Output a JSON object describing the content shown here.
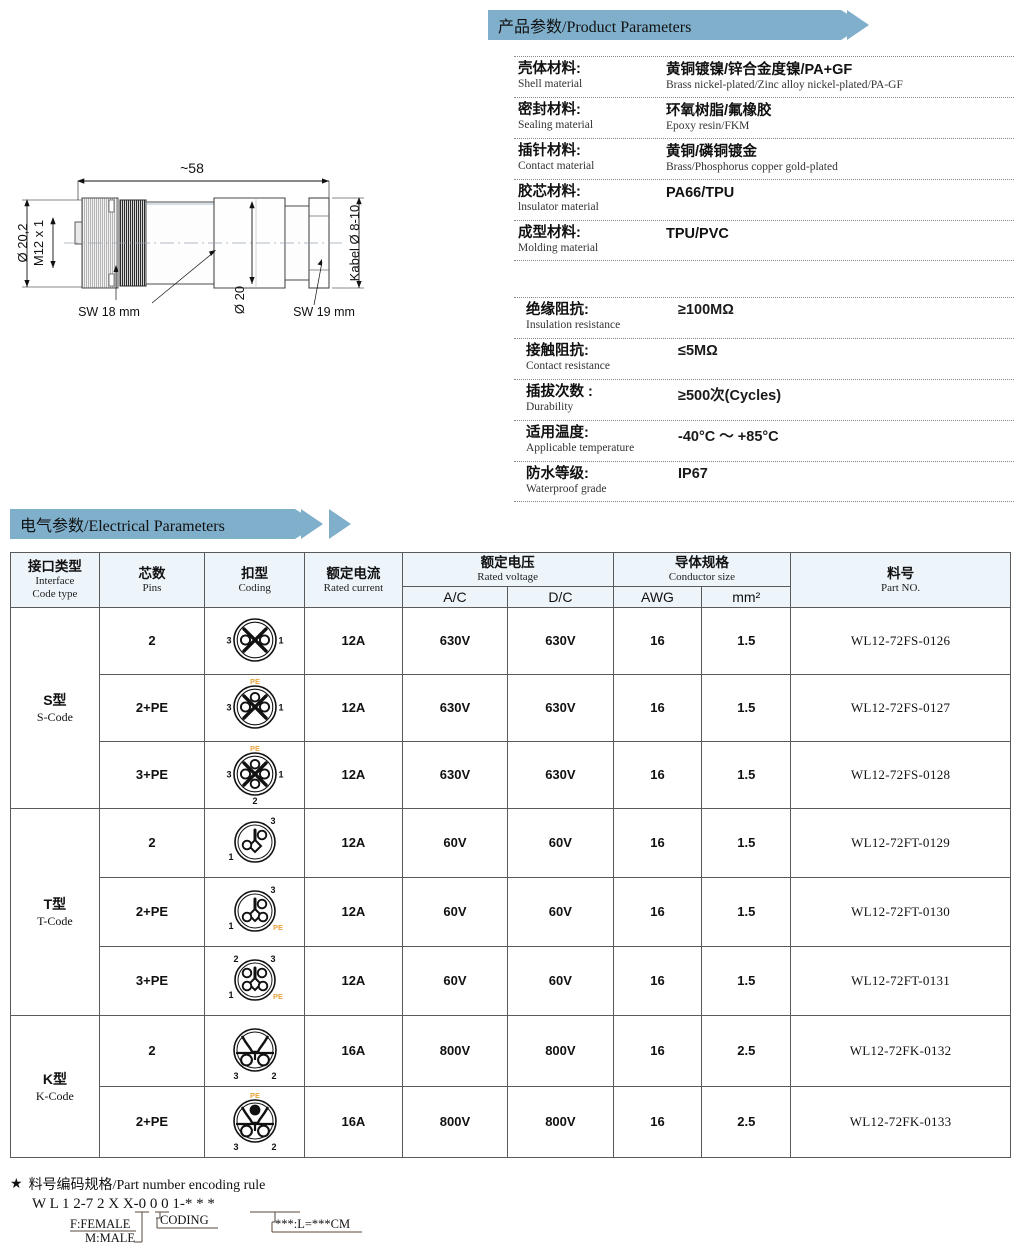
{
  "banners": {
    "product": "产品参数/Product Parameters",
    "electrical": "电气参数/Electrical Parameters"
  },
  "colors": {
    "banner_fill": "#7fafcb",
    "table_header_bg": "#edf4fa",
    "table_border": "#5a5a5a",
    "pe_label": "#E8A33D"
  },
  "drawing": {
    "name": "m12-connector-side-view",
    "dim_length": "~58",
    "dim_outer_diameter": "Ø 20,2",
    "dim_thread": "M12 x 1",
    "dim_body_diameter": "Ø 20",
    "dim_cable": "Kabel Ø 8-10",
    "callout_sw18": "SW 18 mm",
    "callout_sw19": "SW 19 mm"
  },
  "product_parameters": {
    "materials": [
      {
        "label_cn": "壳体材料:",
        "label_en": "Shell material",
        "value_cn": "黄铜镀镍/锌合金度镍/PA+GF",
        "value_en": "Brass nickel-plated/Zinc alloy nickel-plated/PA-GF"
      },
      {
        "label_cn": "密封材料:",
        "label_en": "Sealing material",
        "value_cn": "环氧树脂/氟橡胶",
        "value_en": "Epoxy resin/FKM"
      },
      {
        "label_cn": "插针材料:",
        "label_en": "Contact material",
        "value_cn": "黄铜/磷铜镀金",
        "value_en": "Brass/Phosphorus copper gold-plated"
      },
      {
        "label_cn": "胶芯材料:",
        "label_en": "lnsulator material",
        "value_cn": "PA66/TPU",
        "value_en": ""
      },
      {
        "label_cn": "成型材料:",
        "label_en": "Molding material",
        "value_cn": "TPU/PVC",
        "value_en": ""
      }
    ],
    "performance": [
      {
        "label_cn": "绝缘阻抗:",
        "label_en": "Insulation resistance",
        "value": "≥100MΩ"
      },
      {
        "label_cn": "接触阻抗:",
        "label_en": "Contact resistance",
        "value": "≤5MΩ"
      },
      {
        "label_cn": "插拔次数 :",
        "label_en": "Durability",
        "value": "≥500次(Cycles)"
      },
      {
        "label_cn": "适用温度:",
        "label_en": "Applicable temperature",
        "value": "-40°C ～ +85°C"
      },
      {
        "label_cn": "防水等级:",
        "label_en": "Waterproof grade",
        "value": "IP67"
      }
    ]
  },
  "electrical_table": {
    "headers": {
      "interface_cn": "接口类型",
      "interface_en_1": "Interface",
      "interface_en_2": "Code  type",
      "pins_cn": "芯数",
      "pins_en": "Pins",
      "coding_cn": "扣型",
      "coding_en": "Coding",
      "current_cn": "额定电流",
      "current_en": "Rated current",
      "voltage_cn": "额定电压",
      "voltage_en": "Rated voltage",
      "voltage_ac": "A/C",
      "voltage_dc": "D/C",
      "conductor_cn": "导体规格",
      "conductor_en": "Conductor size",
      "conductor_awg": "AWG",
      "conductor_mm2": "mm²",
      "partno_cn": "料号",
      "partno_en": "Part NO."
    },
    "groups": [
      {
        "code_cn": "S型",
        "code_en": "S-Code",
        "pin_style": "s",
        "rows": [
          {
            "pins": "2",
            "pin_labels": [
              "3",
              "1"
            ],
            "current": "12A",
            "ac": "630V",
            "dc": "630V",
            "awg": "16",
            "mm2": "1.5",
            "part_no": "WL12-72FS-0126"
          },
          {
            "pins": "2+PE",
            "pin_labels": [
              "3",
              "1",
              "PE"
            ],
            "current": "12A",
            "ac": "630V",
            "dc": "630V",
            "awg": "16",
            "mm2": "1.5",
            "part_no": "WL12-72FS-0127"
          },
          {
            "pins": "3+PE",
            "pin_labels": [
              "3",
              "1",
              "PE",
              "2"
            ],
            "current": "12A",
            "ac": "630V",
            "dc": "630V",
            "awg": "16",
            "mm2": "1.5",
            "part_no": "WL12-72FS-0128"
          }
        ]
      },
      {
        "code_cn": "T型",
        "code_en": "T-Code",
        "pin_style": "t",
        "rows": [
          {
            "pins": "2",
            "pin_labels": [
              "1",
              "3"
            ],
            "current": "12A",
            "ac": "60V",
            "dc": "60V",
            "awg": "16",
            "mm2": "1.5",
            "part_no": "WL12-72FT-0129"
          },
          {
            "pins": "2+PE",
            "pin_labels": [
              "1",
              "3",
              "PE"
            ],
            "current": "12A",
            "ac": "60V",
            "dc": "60V",
            "awg": "16",
            "mm2": "1.5",
            "part_no": "WL12-72FT-0130"
          },
          {
            "pins": "3+PE",
            "pin_labels": [
              "1",
              "2",
              "3",
              "PE"
            ],
            "current": "12A",
            "ac": "60V",
            "dc": "60V",
            "awg": "16",
            "mm2": "1.5",
            "part_no": "WL12-72FT-0131"
          }
        ]
      },
      {
        "code_cn": "K型",
        "code_en": "K-Code",
        "pin_style": "k",
        "rows": [
          {
            "pins": "2",
            "pin_labels": [
              "3",
              "2"
            ],
            "current": "16A",
            "ac": "800V",
            "dc": "800V",
            "awg": "16",
            "mm2": "2.5",
            "part_no": "WL12-72FK-0132"
          },
          {
            "pins": "2+PE",
            "pin_labels": [
              "3",
              "2",
              "PE"
            ],
            "current": "16A",
            "ac": "800V",
            "dc": "800V",
            "awg": "16",
            "mm2": "2.5",
            "part_no": "WL12-72FK-0133"
          }
        ]
      }
    ]
  },
  "encoding_rule": {
    "star": "★",
    "title": "料号编码规格/Part number encoding rule",
    "pattern": "W L 1 2-7 2 X X-0 0 0 1-* * *",
    "note_female": "F:FEMALE",
    "note_male": "M:MALE",
    "note_coding": "CODING",
    "note_length": "***:L=***CM"
  }
}
